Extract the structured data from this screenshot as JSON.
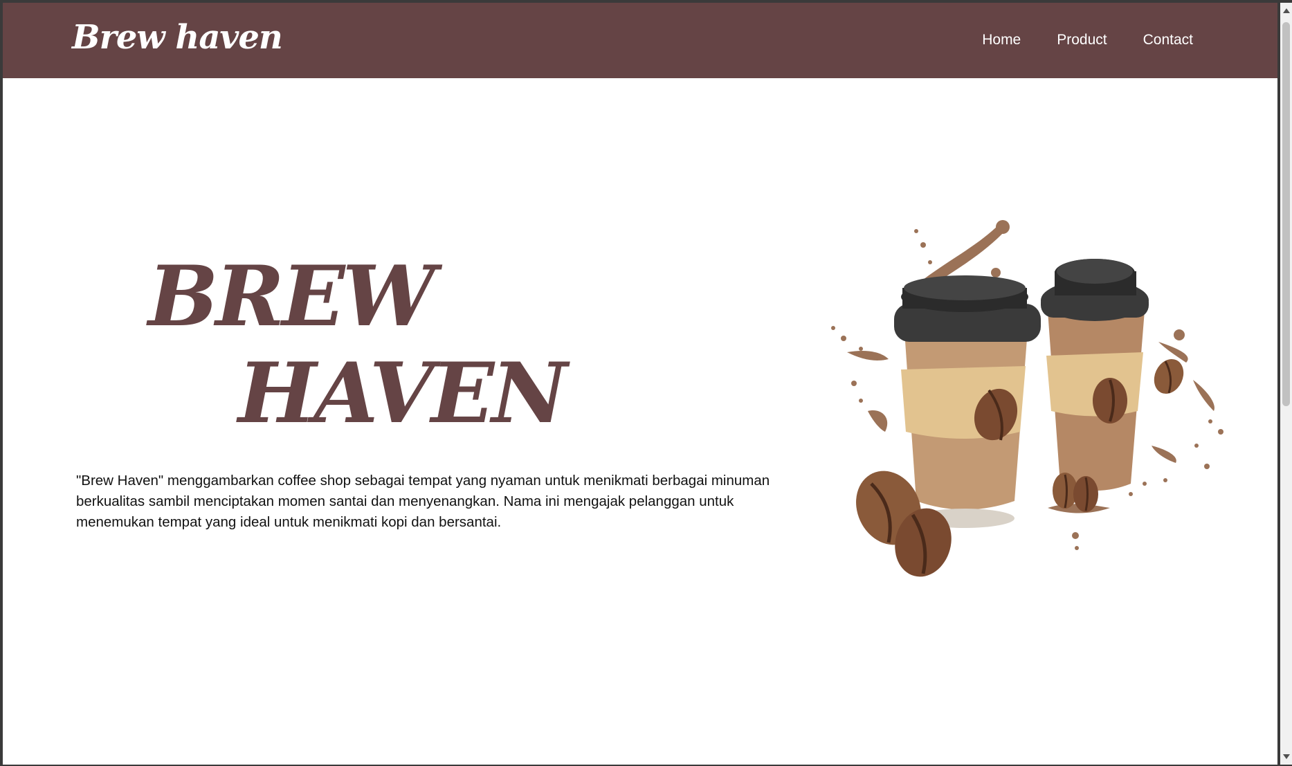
{
  "navbar": {
    "brand": "Brew haven",
    "links": [
      "Home",
      "Product",
      "Contact"
    ]
  },
  "hero": {
    "title_line1": "BREW",
    "title_line2": "HAVEN",
    "description": "\"Brew Haven\" menggambarkan coffee shop sebagai tempat yang nyaman untuk menikmati berbagai minuman berkualitas sambil menciptakan momen santai dan menyenangkan. Nama ini mengajak pelanggan untuk menemukan tempat yang ideal untuk menikmati kopi dan bersantai."
  },
  "colors": {
    "navbar_bg": "#654445",
    "title_color": "#654445",
    "cup_lid": "#3a3a3a",
    "cup_body": "#c39a74",
    "cup_sleeve": "#e2c38f",
    "bean": "#7a4a30"
  }
}
